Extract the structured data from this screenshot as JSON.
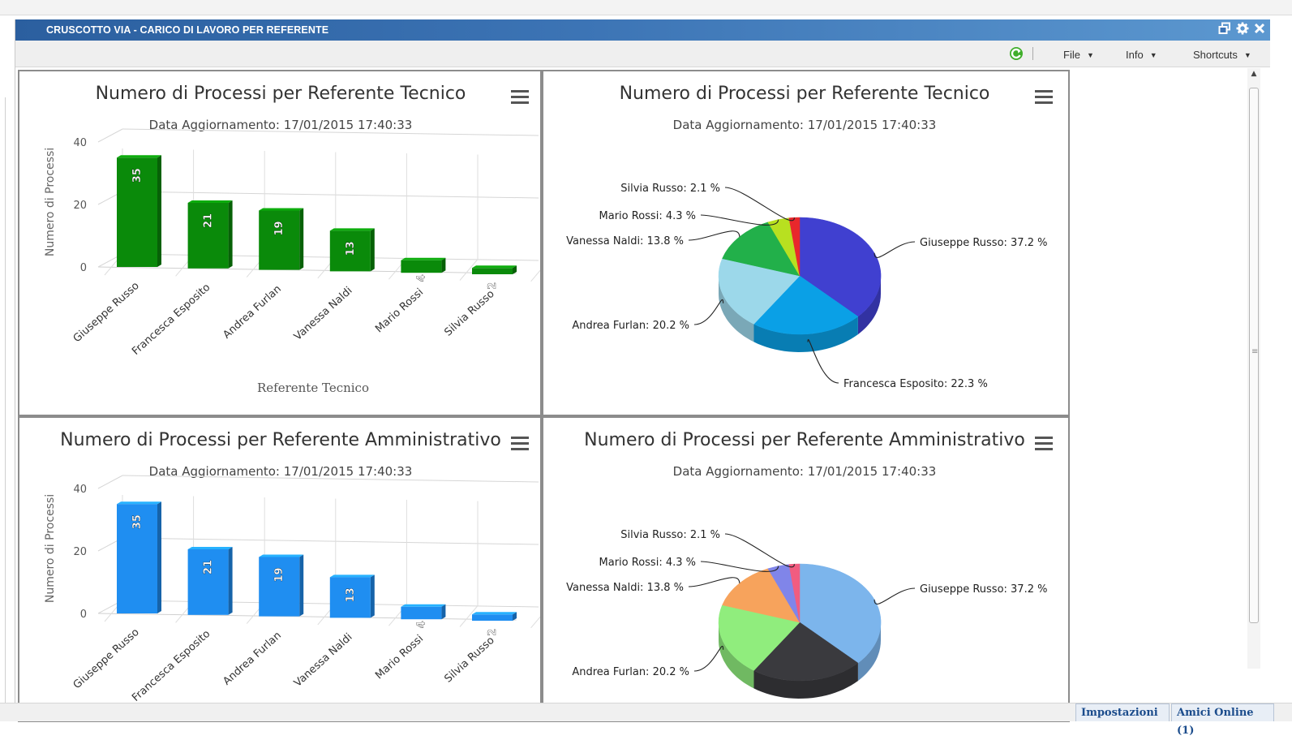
{
  "window": {
    "title": "CRUSCOTTO VIA - CARICO DI LAVORO PER REFERENTE",
    "restore_icon": "restore-icon",
    "settings_icon": "gear-icon",
    "close_icon": "close-icon"
  },
  "toolbar": {
    "refresh_icon": "refresh-icon",
    "menus": [
      "File",
      "Info",
      "Shortcuts"
    ]
  },
  "bottom_tabs": [
    "Impostazioni",
    "Amici Online (1)"
  ],
  "colors": {
    "bar_green": "#0a8a0a",
    "bar_blue": "#1f8ef1",
    "title_bar": "#3c74b5"
  },
  "chart_data": [
    {
      "type": "bar",
      "style": "3d",
      "title": "Numero di Processi per Referente Tecnico",
      "subtitle": "Data Aggiornamento: 17/01/2015 17:40:33",
      "menu_icon": "hamburger-icon",
      "categories": [
        "Giuseppe Russo",
        "Francesca Esposito",
        "Andrea Furlan",
        "Vanessa Naldi",
        "Mario Rossi",
        "Silvia Russo"
      ],
      "values": [
        35,
        21,
        19,
        13,
        4,
        2
      ],
      "data_labels": [
        "35",
        "21",
        "19",
        "13",
        "4",
        "2"
      ],
      "xlabel": "Referente Tecnico",
      "ylabel": "Numero di Processi",
      "yticks": [
        "0",
        "20",
        "40"
      ],
      "ylim": [
        0,
        40
      ],
      "color": "#0a8a0a",
      "grid": true
    },
    {
      "type": "pie",
      "style": "3d",
      "title": "Numero di Processi per Referente Tecnico",
      "subtitle": "Data Aggiornamento: 17/01/2015 17:40:33",
      "menu_icon": "hamburger-icon",
      "slices": [
        {
          "label": "Giuseppe Russo: 37.2 %",
          "value": 37.2,
          "color": "#4040d0"
        },
        {
          "label": "Francesca Esposito: 22.3 %",
          "value": 22.3,
          "color": "#0aa0e6"
        },
        {
          "label": "Andrea Furlan: 20.2 %",
          "value": 20.2,
          "color": "#9cd8ea"
        },
        {
          "label": "Vanessa Naldi: 13.8 %",
          "value": 13.8,
          "color": "#22b04a"
        },
        {
          "label": "Mario Rossi: 4.3 %",
          "value": 4.3,
          "color": "#b8e020"
        },
        {
          "label": "Silvia Russo: 2.1 %",
          "value": 2.1,
          "color": "#e8282c"
        }
      ]
    },
    {
      "type": "bar",
      "style": "3d",
      "title": "Numero di Processi per Referente Amministrativo",
      "subtitle": "Data Aggiornamento: 17/01/2015 17:40:33",
      "menu_icon": "hamburger-icon",
      "categories": [
        "Giuseppe Russo",
        "Francesca Esposito",
        "Andrea Furlan",
        "Vanessa Naldi",
        "Mario Rossi",
        "Silvia Russo"
      ],
      "values": [
        35,
        21,
        19,
        13,
        4,
        2
      ],
      "data_labels": [
        "35",
        "21",
        "19",
        "13",
        "4",
        "2"
      ],
      "xlabel": "",
      "ylabel": "Numero di Processi",
      "yticks": [
        "0",
        "20",
        "40"
      ],
      "ylim": [
        0,
        40
      ],
      "color": "#1f8ef1",
      "grid": true
    },
    {
      "type": "pie",
      "style": "3d",
      "title": "Numero di Processi per Referente Amministrativo",
      "subtitle": "Data Aggiornamento: 17/01/2015 17:40:33",
      "menu_icon": "hamburger-icon",
      "slices": [
        {
          "label": "Giuseppe Russo: 37.2 %",
          "value": 37.2,
          "color": "#7cb5ec"
        },
        {
          "label": "",
          "value": 22.3,
          "color": "#3a3a3e"
        },
        {
          "label": "Andrea Furlan: 20.2 %",
          "value": 20.2,
          "color": "#90ed7d"
        },
        {
          "label": "Vanessa Naldi: 13.8 %",
          "value": 13.8,
          "color": "#f7a35c"
        },
        {
          "label": "Mario Rossi: 4.3 %",
          "value": 4.3,
          "color": "#8085e9"
        },
        {
          "label": "Silvia Russo: 2.1 %",
          "value": 2.1,
          "color": "#f15c80"
        }
      ]
    }
  ]
}
